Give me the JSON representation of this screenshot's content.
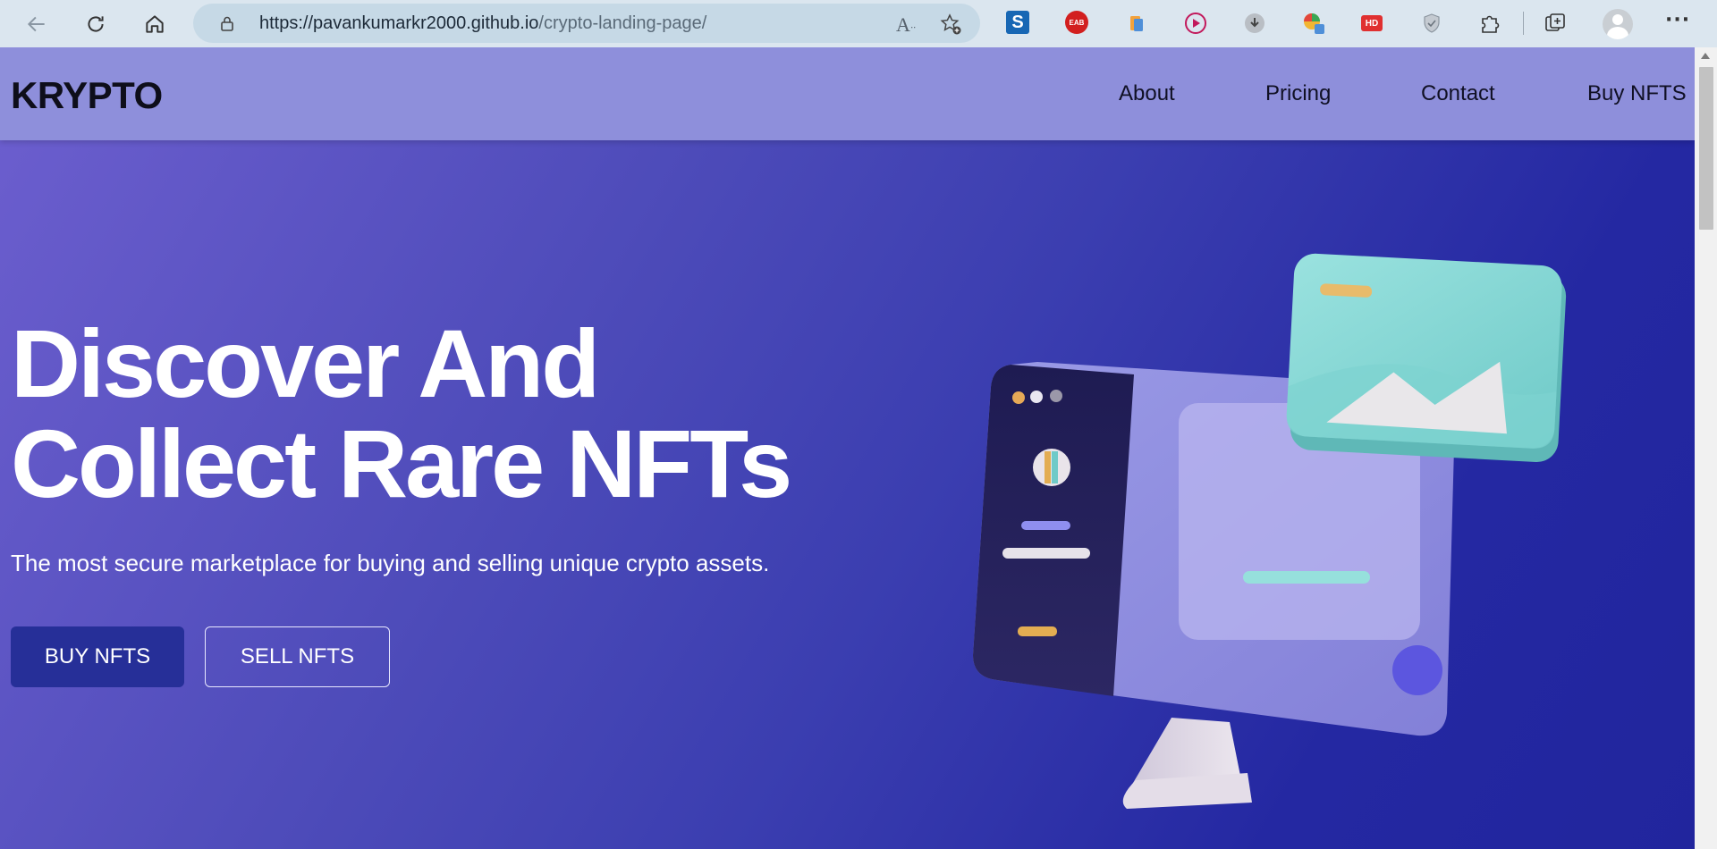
{
  "browser": {
    "url_host": "https://pavankumarkr2000.github.io",
    "url_path": "/crypto-landing-page/",
    "ext_s_label": "S",
    "ext_eab_label": "EAB",
    "ext_hd_label": "HD",
    "more_label": "···"
  },
  "site": {
    "logo": "KRYPTO",
    "nav": [
      "About",
      "Pricing",
      "Contact",
      "Buy NFTS"
    ]
  },
  "hero": {
    "title_line1": "Discover And",
    "title_line2": "Collect Rare NFTs",
    "subtitle": "The most secure marketplace for buying and selling unique crypto assets.",
    "buy_label": "BUY NFTS",
    "sell_label": "SELL NFTS"
  },
  "colors": {
    "header_bg": "#8e8fdb",
    "hero_bg_start": "#6d5fcf",
    "hero_bg_end": "#21259d",
    "buy_button": "#262f98"
  }
}
